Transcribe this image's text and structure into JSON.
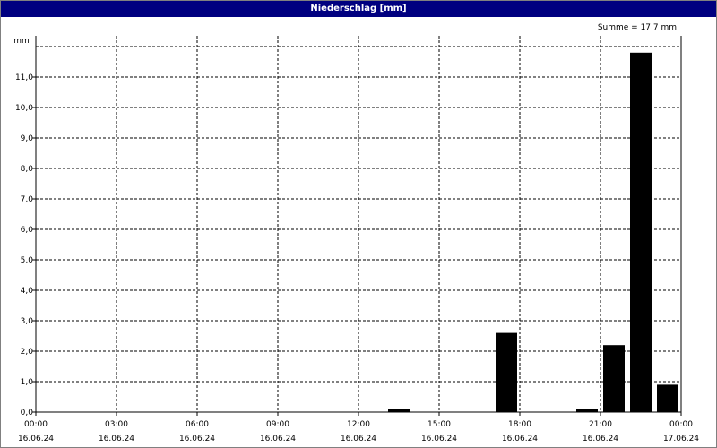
{
  "window": {
    "title": "Niederschlag [mm]"
  },
  "summary": {
    "text": "Summe = 17,7 mm"
  },
  "colors": {
    "titlebar": "#000080",
    "bar": "#000000",
    "grid": "#000000"
  },
  "chart_data": {
    "type": "bar",
    "title": "Niederschlag [mm]",
    "ylabel": "mm",
    "xlabel": "",
    "ylim": [
      0,
      12
    ],
    "yticks": [
      "0,0",
      "1,0",
      "2,0",
      "3,0",
      "4,0",
      "5,0",
      "6,0",
      "7,0",
      "8,0",
      "9,0",
      "10,0",
      "11,0"
    ],
    "xlim": [
      0,
      24
    ],
    "xticks": [
      {
        "time": "00:00",
        "date": "16.06.24"
      },
      {
        "time": "03:00",
        "date": "16.06.24"
      },
      {
        "time": "06:00",
        "date": "16.06.24"
      },
      {
        "time": "09:00",
        "date": "16.06.24"
      },
      {
        "time": "12:00",
        "date": "16.06.24"
      },
      {
        "time": "15:00",
        "date": "16.06.24"
      },
      {
        "time": "18:00",
        "date": "16.06.24"
      },
      {
        "time": "21:00",
        "date": "16.06.24"
      },
      {
        "time": "00:00",
        "date": "17.06.24"
      }
    ],
    "grid": "dashed",
    "bars": [
      {
        "hour": "13:00",
        "value": 0.1
      },
      {
        "hour": "17:00",
        "value": 2.6
      },
      {
        "hour": "20:00",
        "value": 0.1
      },
      {
        "hour": "21:00",
        "value": 2.2
      },
      {
        "hour": "22:00",
        "value": 11.8
      },
      {
        "hour": "23:00",
        "value": 0.9
      }
    ]
  }
}
